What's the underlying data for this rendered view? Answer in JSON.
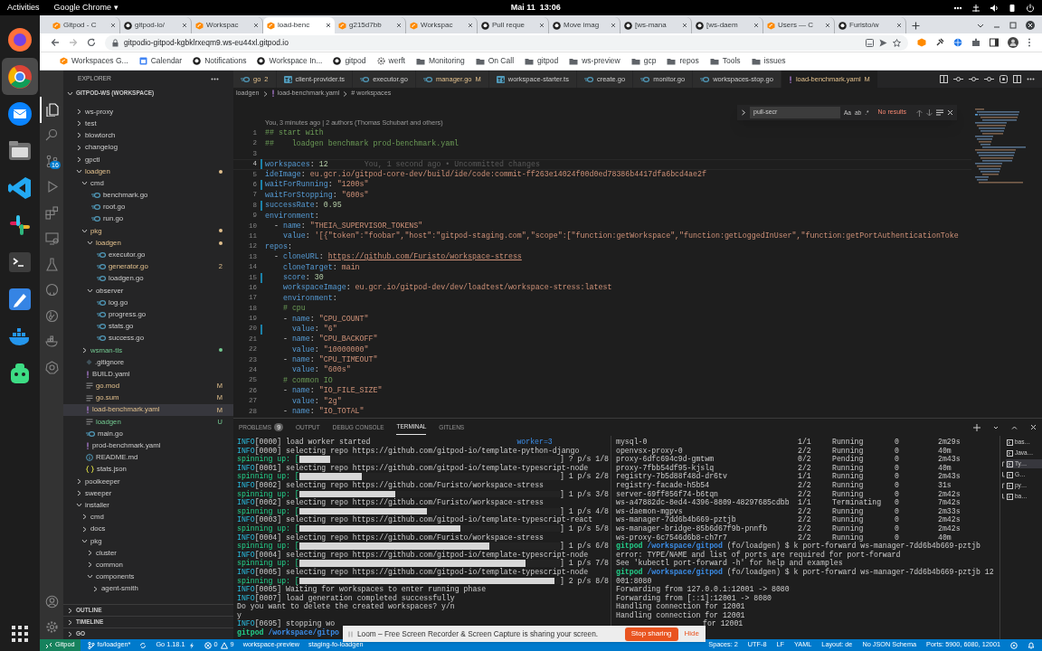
{
  "top_bar": {
    "activities": "Activities",
    "app": "Google Chrome ▾",
    "clock": "Mai 11  13:06"
  },
  "dock": [
    {
      "kind": "fox",
      "selected": false
    },
    {
      "kind": "chrome",
      "selected": true
    },
    {
      "kind": "mail",
      "selected": false
    },
    {
      "kind": "files",
      "selected": false
    },
    {
      "kind": "code",
      "selected": false
    },
    {
      "kind": "slack",
      "selected": false
    },
    {
      "kind": "terminal",
      "selected": false
    },
    {
      "kind": "pen",
      "selected": false
    },
    {
      "kind": "whale",
      "selected": false
    },
    {
      "kind": "robot",
      "selected": false
    }
  ],
  "browser": {
    "tabs": [
      {
        "title": "Gitpod - C",
        "kind": "gitpod",
        "selected": false
      },
      {
        "title": "gitpod-io/",
        "kind": "github",
        "selected": false
      },
      {
        "title": "Workspac",
        "kind": "gitpod",
        "selected": false
      },
      {
        "title": "load-benc",
        "kind": "gitpod",
        "selected": true
      },
      {
        "title": "g215d7bb",
        "kind": "gitpod",
        "selected": false
      },
      {
        "title": "Workspac",
        "kind": "gitpod",
        "selected": false
      },
      {
        "title": "Pull reque",
        "kind": "github",
        "selected": false
      },
      {
        "title": "Move imag",
        "kind": "github",
        "selected": false
      },
      {
        "title": "[ws-mana",
        "kind": "github",
        "selected": false
      },
      {
        "title": "[ws-daem",
        "kind": "github",
        "selected": false
      },
      {
        "title": "Users — C",
        "kind": "gitpod",
        "selected": false
      },
      {
        "title": "Furisto/w",
        "kind": "github",
        "selected": false
      }
    ],
    "url": "gitpodio-gitpod-kgbklrxeqm9.ws-eu44xl.gitpod.io",
    "bookmarks": [
      {
        "label": "Workspaces G...",
        "kind": "gitpod"
      },
      {
        "label": "Calendar",
        "kind": "calendar"
      },
      {
        "label": "Notifications",
        "kind": "github"
      },
      {
        "label": "Workspace In...",
        "kind": "github"
      },
      {
        "label": "gitpod",
        "kind": "github"
      },
      {
        "label": "werft",
        "kind": "gear"
      },
      {
        "label": "Monitoring",
        "kind": "folder"
      },
      {
        "label": "On Call",
        "kind": "folder"
      },
      {
        "label": "gitpod",
        "kind": "folder"
      },
      {
        "label": "ws-preview",
        "kind": "folder"
      },
      {
        "label": "gcp",
        "kind": "folder"
      },
      {
        "label": "repos",
        "kind": "folder"
      },
      {
        "label": "Tools",
        "kind": "folder"
      },
      {
        "label": "issues",
        "kind": "folder"
      }
    ]
  },
  "activity_bar": {
    "items": [
      {
        "kind": "files",
        "selected": true
      },
      {
        "kind": "search",
        "selected": false
      },
      {
        "kind": "scm",
        "selected": false,
        "badge": "16"
      },
      {
        "kind": "debug",
        "selected": false
      },
      {
        "kind": "extensions",
        "selected": false
      },
      {
        "kind": "remote",
        "selected": false
      },
      {
        "kind": "testing",
        "selected": false
      },
      {
        "kind": "github",
        "selected": false
      },
      {
        "kind": "gitlens",
        "selected": false
      },
      {
        "kind": "docker",
        "selected": false
      },
      {
        "kind": "kubernetes",
        "selected": false
      }
    ],
    "bottom": [
      {
        "kind": "account"
      },
      {
        "kind": "settings"
      }
    ]
  },
  "explorer": {
    "title": "EXPLORER",
    "root": "GITPOD-WS (WORKSPACE)",
    "tree": [
      {
        "label": "ws-proxy",
        "kind": "folder",
        "expanded": false,
        "selected": false,
        "modified": false,
        "untracked": false
      },
      {
        "label": "test",
        "kind": "folder",
        "expanded": false,
        "selected": false,
        "modified": false,
        "untracked": false
      },
      {
        "label": "blowtorch",
        "kind": "folder",
        "expanded": false,
        "selected": false,
        "modified": false,
        "untracked": false
      },
      {
        "label": "changelog",
        "kind": "folder",
        "expanded": false,
        "selected": false,
        "modified": false,
        "untracked": false
      },
      {
        "label": "gpctl",
        "kind": "folder",
        "expanded": false,
        "selected": false,
        "modified": false,
        "untracked": false
      },
      {
        "label": "loadgen",
        "kind": "folder",
        "expanded": true,
        "selected": false,
        "modified": true,
        "untracked": false,
        "children": [
          {
            "label": "cmd",
            "kind": "folder",
            "expanded": true,
            "selected": false,
            "modified": false,
            "untracked": false,
            "children": [
              {
                "label": "benchmark.go",
                "kind": "go",
                "selected": false,
                "modified": false,
                "untracked": false
              },
              {
                "label": "root.go",
                "kind": "go",
                "selected": false,
                "modified": false,
                "untracked": false
              },
              {
                "label": "run.go",
                "kind": "go",
                "selected": false,
                "modified": false,
                "untracked": false
              }
            ]
          },
          {
            "label": "pkg",
            "kind": "folder",
            "expanded": true,
            "selected": false,
            "modified": true,
            "untracked": false,
            "children": [
              {
                "label": "loadgen",
                "kind": "folder",
                "expanded": true,
                "selected": false,
                "modified": true,
                "untracked": false,
                "children": [
                  {
                    "label": "executor.go",
                    "kind": "go",
                    "selected": false,
                    "modified": false,
                    "untracked": false
                  },
                  {
                    "label": "generator.go",
                    "kind": "go",
                    "selected": false,
                    "modified": true,
                    "untracked": false,
                    "badge": "2"
                  },
                  {
                    "label": "loadgen.go",
                    "kind": "go",
                    "selected": false,
                    "modified": false,
                    "untracked": false
                  }
                ]
              },
              {
                "label": "observer",
                "kind": "folder",
                "expanded": true,
                "selected": false,
                "modified": false,
                "untracked": false,
                "children": [
                  {
                    "label": "log.go",
                    "kind": "go",
                    "selected": false,
                    "modified": false,
                    "untracked": false
                  },
                  {
                    "label": "progress.go",
                    "kind": "go",
                    "selected": false,
                    "modified": false,
                    "untracked": false
                  },
                  {
                    "label": "stats.go",
                    "kind": "go",
                    "selected": false,
                    "modified": false,
                    "untracked": false
                  },
                  {
                    "label": "success.go",
                    "kind": "go",
                    "selected": false,
                    "modified": false,
                    "untracked": false
                  }
                ]
              }
            ]
          },
          {
            "label": "wsman-tls",
            "kind": "folder",
            "expanded": false,
            "selected": false,
            "modified": false,
            "untracked": true
          },
          {
            "label": ".gitignore",
            "kind": "git",
            "selected": false,
            "modified": false,
            "untracked": false
          },
          {
            "label": "BUILD.yaml",
            "kind": "yaml",
            "selected": false,
            "modified": false,
            "untracked": false
          },
          {
            "label": "go.mod",
            "kind": "lines",
            "selected": false,
            "modified": true,
            "untracked": false,
            "badge": "M"
          },
          {
            "label": "go.sum",
            "kind": "lines",
            "selected": false,
            "modified": true,
            "untracked": false,
            "badge": "M"
          },
          {
            "label": "load-benchmark.yaml",
            "kind": "yaml",
            "selected": true,
            "modified": true,
            "untracked": false,
            "badge": "M"
          },
          {
            "label": "loadgen",
            "kind": "lines",
            "selected": false,
            "modified": false,
            "untracked": true,
            "badge": "U"
          },
          {
            "label": "main.go",
            "kind": "go",
            "selected": false,
            "modified": false,
            "untracked": false
          },
          {
            "label": "prod-benchmark.yaml",
            "kind": "yaml",
            "selected": false,
            "modified": false,
            "untracked": false
          },
          {
            "label": "README.md",
            "kind": "info",
            "selected": false,
            "modified": false,
            "untracked": false
          },
          {
            "label": "stats.json",
            "kind": "json",
            "selected": false,
            "modified": false,
            "untracked": false
          }
        ]
      },
      {
        "label": "poolkeeper",
        "kind": "folder",
        "expanded": false,
        "selected": false,
        "modified": false,
        "untracked": false
      },
      {
        "label": "sweeper",
        "kind": "folder",
        "expanded": false,
        "selected": false,
        "modified": false,
        "untracked": false
      },
      {
        "label": "installer",
        "kind": "folder",
        "expanded": true,
        "selected": false,
        "modified": false,
        "untracked": false,
        "children": [
          {
            "label": "cmd",
            "kind": "folder",
            "expanded": false,
            "selected": false,
            "modified": false,
            "untracked": false
          },
          {
            "label": "docs",
            "kind": "folder",
            "expanded": false,
            "selected": false,
            "modified": false,
            "untracked": false
          },
          {
            "label": "pkg",
            "kind": "folder",
            "expanded": true,
            "selected": false,
            "modified": false,
            "untracked": false,
            "children": [
              {
                "label": "cluster",
                "kind": "folder",
                "expanded": false,
                "selected": false,
                "modified": false,
                "untracked": false
              },
              {
                "label": "common",
                "kind": "folder",
                "expanded": false,
                "selected": false,
                "modified": false,
                "untracked": false
              },
              {
                "label": "components",
                "kind": "folder",
                "expanded": true,
                "selected": false,
                "modified": false,
                "untracked": false,
                "children": [
                  {
                    "label": "agent-smith",
                    "kind": "folder",
                    "expanded": false,
                    "selected": false,
                    "modified": false,
                    "untracked": false
                  }
                ]
              }
            ]
          }
        ]
      }
    ],
    "sections": [
      "OUTLINE",
      "TIMELINE",
      "GO"
    ]
  },
  "editor": {
    "tabs": [
      {
        "label": "go",
        "kind": "go",
        "selected": false,
        "modified": true,
        "badge": "2"
      },
      {
        "label": "client-provider.ts",
        "kind": "ts",
        "selected": false,
        "modified": false
      },
      {
        "label": "executor.go",
        "kind": "go",
        "selected": false,
        "modified": false
      },
      {
        "label": "manager.go",
        "kind": "go",
        "selected": false,
        "modified": true,
        "badge": "M"
      },
      {
        "label": "workspace-starter.ts",
        "kind": "ts",
        "selected": false,
        "modified": false
      },
      {
        "label": "create.go",
        "kind": "go",
        "selected": false,
        "modified": false
      },
      {
        "label": "monitor.go",
        "kind": "go",
        "selected": false,
        "modified": false
      },
      {
        "label": "workspaces-stop.go",
        "kind": "go",
        "selected": false,
        "modified": false
      },
      {
        "label": "load-benchmark.yaml",
        "kind": "yaml",
        "selected": true,
        "modified": true,
        "badge": "M"
      }
    ],
    "breadcrumb": [
      "loadgen",
      "load-benchmark.yaml",
      "# workspaces"
    ],
    "find": {
      "query": "pull-secr",
      "options": [
        "Aa",
        "ab",
        ".*"
      ],
      "result": "No results"
    },
    "codelens": "You, 3 minutes ago | 2 authors (Thomas Schubart and others)",
    "lines": [
      {
        "n": "1",
        "text": "## start with",
        "changed": false,
        "cursor": false
      },
      {
        "n": "2",
        "text": "##    loadgen benchmark prod-benchmark.yaml",
        "changed": false,
        "cursor": false
      },
      {
        "n": "3",
        "changed": false,
        "cursor": false
      },
      {
        "n": "4",
        "text": "workspaces: 12",
        "changed": true,
        "cursor": true,
        "blame": "You, 1 second ago • Uncommitted changes"
      },
      {
        "n": "5",
        "text": "ideImage: eu.gcr.io/gitpod-core-dev/build/ide/code:commit-ff263e14024f00d0ed78386b4417dfa6bcd4ae2f",
        "changed": false,
        "cursor": false
      },
      {
        "n": "6",
        "text": "waitForRunning: \"1200s\"",
        "changed": true,
        "cursor": false
      },
      {
        "n": "7",
        "text": "waitForStopping: \"600s\"",
        "changed": false,
        "cursor": false
      },
      {
        "n": "8",
        "text": "successRate: 0.95",
        "changed": true,
        "cursor": false
      },
      {
        "n": "9",
        "text": "environment:",
        "changed": false,
        "cursor": false
      },
      {
        "n": "10",
        "text": "  - name: \"THEIA_SUPERVISOR_TOKENS\"",
        "changed": false,
        "cursor": false
      },
      {
        "n": "11",
        "text": "    value: '[{\"token\":\"foobar\",\"host\":\"gitpod-staging.com\",\"scope\":[\"function:getWorkspace\",\"function:getLoggedInUser\",\"function:getPortAuthenticationToke",
        "changed": false,
        "cursor": false
      },
      {
        "n": "12",
        "text": "repos:",
        "changed": false,
        "cursor": false
      },
      {
        "n": "13",
        "text": "  - cloneURL: https://github.com/Furisto/workspace-stress",
        "changed": false,
        "cursor": false
      },
      {
        "n": "14",
        "text": "    cloneTarget: main",
        "changed": false,
        "cursor": false
      },
      {
        "n": "15",
        "text": "    score: 30",
        "changed": true,
        "cursor": false
      },
      {
        "n": "16",
        "text": "    workspaceImage: eu.gcr.io/gitpod-dev/dev/loadtest/workspace-stress:latest",
        "changed": false,
        "cursor": false
      },
      {
        "n": "17",
        "text": "    environment:",
        "changed": false,
        "cursor": false
      },
      {
        "n": "18",
        "text": "    # cpu",
        "changed": false,
        "cursor": false
      },
      {
        "n": "19",
        "text": "    - name: \"CPU_COUNT\"",
        "changed": false,
        "cursor": false
      },
      {
        "n": "20",
        "text": "      value: \"6\"",
        "changed": true,
        "cursor": false
      },
      {
        "n": "21",
        "text": "    - name: \"CPU_BACKOFF\"",
        "changed": false,
        "cursor": false
      },
      {
        "n": "22",
        "text": "      value: \"10000000\"",
        "changed": false,
        "cursor": false
      },
      {
        "n": "23",
        "text": "    - name: \"CPU_TIMEOUT\"",
        "changed": false,
        "cursor": false
      },
      {
        "n": "24",
        "text": "      value: \"600s\"",
        "changed": false,
        "cursor": false
      },
      {
        "n": "25",
        "text": "    # common IO",
        "changed": false,
        "cursor": false
      },
      {
        "n": "26",
        "text": "    - name: \"IO_FILE_SIZE\"",
        "changed": false,
        "cursor": false
      },
      {
        "n": "27",
        "text": "      value: \"2g\"",
        "changed": false,
        "cursor": false
      },
      {
        "n": "28",
        "text": "    - name: \"IO_TOTAL\"",
        "changed": false,
        "cursor": false
      }
    ]
  },
  "panel": {
    "tabs": [
      {
        "label": "PROBLEMS",
        "selected": false,
        "badge": "9"
      },
      {
        "label": "OUTPUT",
        "selected": false
      },
      {
        "label": "DEBUG CONSOLE",
        "selected": false
      },
      {
        "label": "TERMINAL",
        "selected": true
      },
      {
        "label": "GITLENS",
        "selected": false
      }
    ],
    "terminal_left": [
      {
        "kind": "info",
        "tag": "INFO",
        "text": "[0000] load worker started",
        "field": "worker=3"
      },
      {
        "kind": "info",
        "tag": "INFO",
        "text": "[0000] selecting repo https://github.com/gitpod-io/template-python-django"
      },
      {
        "kind": "spin",
        "label": "spinning up: [",
        "level": 0.12,
        "tail": "] ? p/s 1/8"
      },
      {
        "kind": "info",
        "tag": "INFO",
        "text": "[0001] selecting repo https://github.com/gitpod-io/template-typescript-node"
      },
      {
        "kind": "spin",
        "label": "spinning up: [",
        "level": 0.24,
        "tail": "] 1 p/s 2/8"
      },
      {
        "kind": "info",
        "tag": "INFO",
        "text": "[0002] selecting repo https://github.com/Furisto/workspace-stress"
      },
      {
        "kind": "spin",
        "label": "spinning up: [",
        "level": 0.37,
        "tail": "] 1 p/s 3/8"
      },
      {
        "kind": "info",
        "tag": "INFO",
        "text": "[0002] selecting repo https://github.com/Furisto/workspace-stress"
      },
      {
        "kind": "spin",
        "label": "spinning up: [",
        "level": 0.49,
        "tail": "] 1 p/s 4/8"
      },
      {
        "kind": "info",
        "tag": "INFO",
        "text": "[0003] selecting repo https://github.com/gitpod-io/template-typescript-react"
      },
      {
        "kind": "spin",
        "label": "spinning up: [",
        "level": 0.62,
        "tail": "] 1 p/s 5/8"
      },
      {
        "kind": "info",
        "tag": "INFO",
        "text": "[0004] selecting repo https://github.com/Furisto/workspace-stress"
      },
      {
        "kind": "spin",
        "label": "spinning up: [",
        "level": 0.73,
        "tail": "] 1 p/s 6/8"
      },
      {
        "kind": "info",
        "tag": "INFO",
        "text": "[0004] selecting repo https://github.com/gitpod-io/template-typescript-node"
      },
      {
        "kind": "spin",
        "label": "spinning up: [",
        "level": 0.87,
        "tail": "] 1 p/s 7/8"
      },
      {
        "kind": "info",
        "tag": "INFO",
        "text": "[0005] selecting repo https://github.com/gitpod-io/template-typescript-node"
      },
      {
        "kind": "spin",
        "label": "spinning up: [",
        "level": 0.98,
        "tail": "] 2 p/s 8/8"
      },
      {
        "kind": "info",
        "tag": "INFO",
        "text": "[0005] Waiting for workspaces to enter running phase"
      },
      {
        "kind": "info",
        "tag": "INFO",
        "text": "[0007] load generation completed successfully"
      },
      {
        "kind": "plain",
        "text": "Do you want to delete the created workspaces? y/n"
      },
      {
        "kind": "plain",
        "text": "y"
      },
      {
        "kind": "info",
        "tag": "INFO",
        "text": "[0695] stopping wo"
      },
      {
        "kind": "prompt",
        "user": "gitpod",
        "path": "/workspace/gitpo"
      }
    ],
    "pods": [
      [
        "mysql-0",
        "1/1",
        "Running",
        "0",
        "2m29s"
      ],
      [
        "openvsx-proxy-0",
        "2/2",
        "Running",
        "0",
        "40m"
      ],
      [
        "proxy-6dfc694c9d-gmtwm",
        "0/2",
        "Pending",
        "0",
        "2m43s"
      ],
      [
        "proxy-7fbb54df95-kjslq",
        "2/2",
        "Running",
        "0",
        "40m"
      ],
      [
        "registry-7b5d88f48d-dr6tv",
        "1/1",
        "Running",
        "0",
        "2m43s"
      ],
      [
        "registry-facade-h5b54",
        "2/2",
        "Running",
        "0",
        "31s"
      ],
      [
        "server-69ff856f74-b6tqn",
        "2/2",
        "Running",
        "0",
        "2m42s"
      ],
      [
        "ws-a47882dc-8ed4-4396-8809-48297685cdbb",
        "1/1",
        "Terminating",
        "0",
        "7m42s"
      ],
      [
        "ws-daemon-mgpvs",
        "2/2",
        "Running",
        "0",
        "2m33s"
      ],
      [
        "ws-manager-7dd6b4b669-pztjb",
        "2/2",
        "Running",
        "0",
        "2m42s"
      ],
      [
        "ws-manager-bridge-85b6d67f9b-pnnfb",
        "2/2",
        "Running",
        "0",
        "2m42s"
      ],
      [
        "ws-proxy-6c7546d6b8-ch7r7",
        "2/2",
        "Running",
        "0",
        "40m"
      ]
    ],
    "terminal_right": [
      {
        "kind": "prompt",
        "user": "gitpod",
        "path": "/workspace/gitpod",
        "text": "(fo/loadgen) $ k port-forward ws-manager-7dd6b4b669-pztjb"
      },
      {
        "kind": "plain",
        "text": "error: TYPE/NAME and list of ports are required for port-forward"
      },
      {
        "kind": "plain",
        "text": "See 'kubectl port-forward -h' for help and examples"
      },
      {
        "kind": "prompt",
        "user": "gitpod",
        "path": "/workspace/gitpod",
        "text": "(fo/loadgen) $ k port-forward ws-manager-7dd6b4b669-pztjb 12"
      },
      {
        "kind": "plain",
        "text": "001:8080"
      },
      {
        "kind": "plain",
        "text": "Forwarding from 127.0.0.1:12001 -> 8080"
      },
      {
        "kind": "plain",
        "text": "Forwarding from [::1]:12001 -> 8080"
      },
      {
        "kind": "plain",
        "text": "Handling connection for 12001"
      },
      {
        "kind": "plain",
        "text": "Handling connection for 12001"
      },
      {
        "kind": "partial",
        "text": "for 12001"
      }
    ],
    "terminals": [
      {
        "label": "bas…",
        "kind": "single",
        "selected": false
      },
      {
        "label": "Java…",
        "kind": "single",
        "selected": false
      },
      {
        "label": "Ty…",
        "kind": "group_start",
        "selected": true
      },
      {
        "label": "G…",
        "kind": "group_end",
        "selected": false
      },
      {
        "label": "py…",
        "kind": "group_start",
        "selected": false
      },
      {
        "label": "ba…",
        "kind": "group_end",
        "selected": false
      }
    ]
  },
  "status_bar": {
    "remote": "Gitpod",
    "branch": "fo/loadgen*",
    "go": "Go 1.18.1",
    "errors": "0",
    "warnings": "9",
    "left": [
      "workspace-preview",
      "staging-fo-loadgen"
    ],
    "right": [
      "Spaces: 2",
      "UTF-8",
      "LF",
      "YAML",
      "Layout: de",
      "No JSON Schema",
      "Ports: 5900, 6080, 12001"
    ]
  },
  "loom_banner": {
    "message": "Loom – Free Screen Recorder & Screen Capture is sharing your screen.",
    "stop": "Stop sharing",
    "hide": "Hide"
  }
}
